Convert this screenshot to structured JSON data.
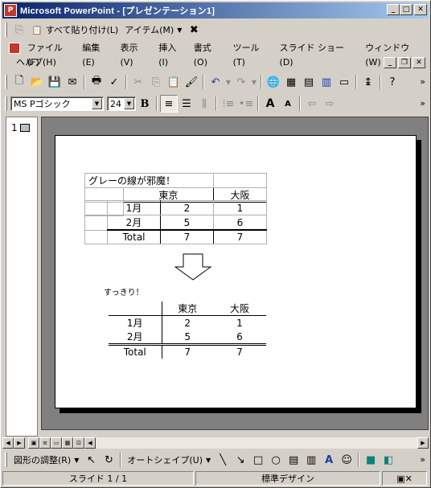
{
  "window": {
    "title": "Microsoft PowerPoint - [プレゼンテーション1]",
    "app_icon": "P"
  },
  "clipboard_bar": {
    "paste_all": "すべて貼り付け(L)",
    "items": "アイテム(M)"
  },
  "menu": {
    "items": [
      "ファイル(F)",
      "編集(E)",
      "表示(V)",
      "挿入(I)",
      "書式(O)",
      "ツール(T)",
      "スライド ショー(D)",
      "ウィンドウ(W)"
    ],
    "help": "ヘルプ(H)"
  },
  "format_bar": {
    "font": "MS Pゴシック",
    "size": "24"
  },
  "outline": {
    "slide_number": "1"
  },
  "slide": {
    "table1": {
      "title": "グレーの線が邪魔！",
      "header": [
        "",
        "東京",
        "大阪"
      ],
      "rows": [
        {
          "label": "1月",
          "tokyo": "2",
          "osaka": "1"
        },
        {
          "label": "2月",
          "tokyo": "5",
          "osaka": "6"
        },
        {
          "label": "Total",
          "tokyo": "7",
          "osaka": "7"
        }
      ]
    },
    "caption": "すっきり！",
    "table2": {
      "header": [
        "",
        "東京",
        "大阪"
      ],
      "rows": [
        {
          "label": "1月",
          "tokyo": "2",
          "osaka": "1"
        },
        {
          "label": "2月",
          "tokyo": "5",
          "osaka": "6"
        },
        {
          "label": "Total",
          "tokyo": "7",
          "osaka": "7"
        }
      ]
    }
  },
  "drawing_bar": {
    "adjust": "図形の調整(R)",
    "autoshape": "オートシェイプ(U)"
  },
  "status": {
    "slide": "スライド 1 / 1",
    "design": "標準デザイン"
  }
}
